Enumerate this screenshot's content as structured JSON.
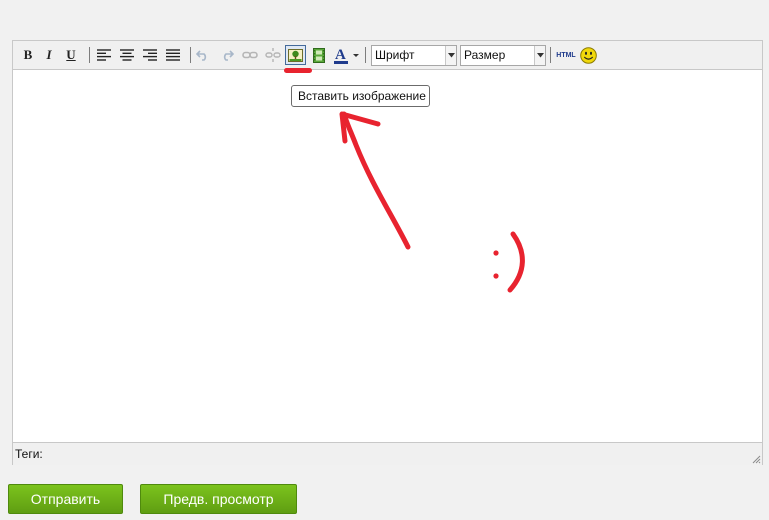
{
  "toolbar": {
    "bold_label": "B",
    "italic_label": "I",
    "underline_label": "U",
    "font_select": {
      "value": "Шрифт"
    },
    "size_select": {
      "value": "Размер"
    },
    "html_label": "HTML",
    "icons": [
      "bold-icon",
      "italic-icon",
      "underline-icon",
      "align-left-icon",
      "align-center-icon",
      "align-right-icon",
      "align-justify-icon",
      "undo-icon",
      "redo-icon",
      "link-icon",
      "unlink-icon",
      "insert-image-icon",
      "insert-video-icon",
      "text-color-icon",
      "html-icon",
      "smiley-icon"
    ],
    "colors": {
      "accent_active": "#446a9a",
      "text_color_bar": "#1f3b8c",
      "smiley": "#f0d80c"
    }
  },
  "tooltip": {
    "text": "Вставить изображение"
  },
  "editor": {
    "text": ""
  },
  "tags": {
    "label": "Теги:"
  },
  "buttons": {
    "submit_label": "Отправить",
    "preview_label": "Предв. просмотр",
    "color": "#6aad17"
  },
  "annotation": {
    "color": "#e8232f"
  }
}
